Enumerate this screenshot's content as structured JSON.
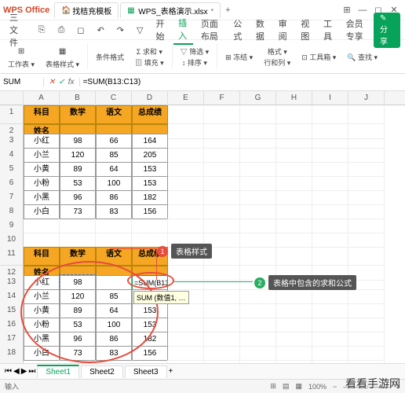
{
  "titlebar": {
    "logo": "WPS Office",
    "tabs": [
      {
        "icon": "home",
        "label": "找桔充模板"
      },
      {
        "icon": "xls",
        "label": "WPS_表格演示.xlsx"
      }
    ],
    "plus": "+"
  },
  "menubar": {
    "items": [
      "三 文件",
      "⎘",
      "⎙",
      "◻",
      "↶",
      "↷",
      "▽"
    ],
    "tabs": [
      "开始",
      "插入",
      "页面布局",
      "公式",
      "数据",
      "审阅",
      "视图",
      "工具",
      "会员专享"
    ],
    "active": "插入",
    "search_placeholder": "Q",
    "extra": [
      "◯",
      "⚘",
      "—",
      "◻",
      "✕"
    ],
    "share": "✎ 分享"
  },
  "toolbar": {
    "worksheet": "工作表 ▾",
    "table_style": "表格样式 ▾",
    "conditional": "条件格式",
    "sum": "Σ 求和 ▾",
    "fill": "▥ 填充 ▾",
    "filter": "▽ 筛选 ▾",
    "sort": "↕ 排序 ▾",
    "freeze": "⊞ 冻结 ▾",
    "format": "格式 ▾",
    "row_col": "行和列 ▾",
    "toolbox": "⊡ 工具箱 ▾",
    "find": "🔍 查找 ▾"
  },
  "formulabar": {
    "name": "SUM",
    "formula": "=SUM(B13:C13)"
  },
  "columns": [
    "",
    "A",
    "B",
    "C",
    "D",
    "E",
    "F",
    "G",
    "H",
    "I",
    "J"
  ],
  "table1": {
    "header_corner": "科目",
    "row_label": "姓名",
    "cols": [
      "数学",
      "语文",
      "总成绩"
    ],
    "rows": [
      [
        "小红",
        "98",
        "66",
        "164"
      ],
      [
        "小兰",
        "120",
        "85",
        "205"
      ],
      [
        "小黄",
        "89",
        "64",
        "153"
      ],
      [
        "小粉",
        "53",
        "100",
        "153"
      ],
      [
        "小黑",
        "96",
        "86",
        "182"
      ],
      [
        "小白",
        "73",
        "83",
        "156"
      ]
    ]
  },
  "table2": {
    "header_corner": "科目",
    "row_label": "姓名",
    "cols": [
      "数学",
      "语文",
      "总成绩"
    ],
    "rows": [
      [
        "小红",
        "98",
        "",
        "=SUM(B13:C13)"
      ],
      [
        "小兰",
        "120",
        "85",
        ""
      ],
      [
        "小黄",
        "89",
        "64",
        "153"
      ],
      [
        "小粉",
        "53",
        "100",
        "153"
      ],
      [
        "小黑",
        "96",
        "86",
        "182"
      ],
      [
        "小白",
        "73",
        "83",
        "156"
      ]
    ],
    "tooltip": "SUM (数值1, …"
  },
  "callouts": {
    "c1_num": "1",
    "c1_text": "表格样式",
    "c2_num": "2",
    "c2_text": "表格中包含的求和公式"
  },
  "sheettabs": [
    "Sheet1",
    "Sheet2",
    "Sheet3"
  ],
  "statusbar": {
    "mode": "输入",
    "zoom": "100%"
  },
  "watermark": "看看手游网"
}
